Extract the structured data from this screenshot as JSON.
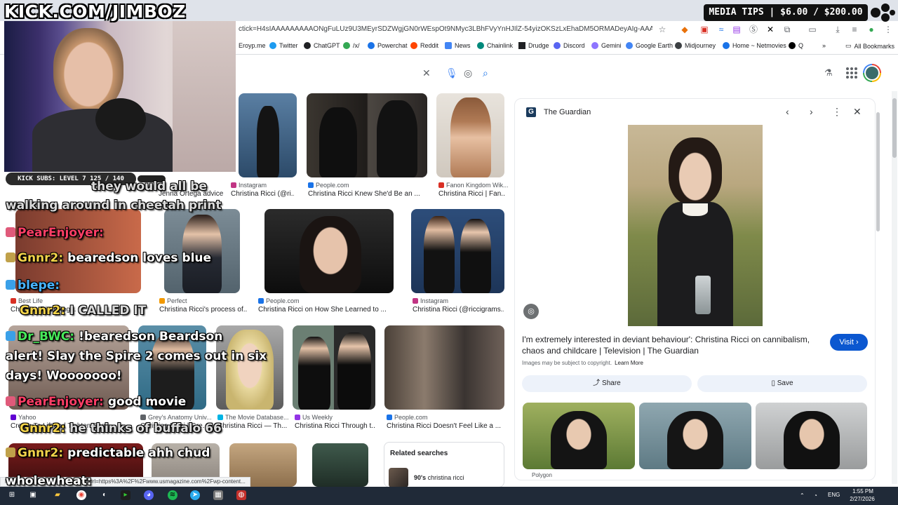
{
  "browser": {
    "url": "ctick=H4sIAAAAAAAAAONgFuLUz9U3MEyrSDZWgjGN0rWEspOt9NMyc3LBhFVyYnHJIlZ-54yizOKSzLxEhaDM5ORMADeyAIg-AAAA&sxsrf=AN...",
    "bookmarks": [
      "Eroyp.me",
      "Twitter",
      "ChatGPT",
      "/x/",
      "Powerchat",
      "Reddit",
      "News",
      "Chainlink",
      "Drudge",
      "Discord",
      "Gemini",
      "Google Earth",
      "Midjourney",
      "Home ~ Netmovies",
      "Q"
    ],
    "all_bookmarks": "All Bookmarks"
  },
  "grid": {
    "row1": [
      {
        "source": "Instagram",
        "caption": "Christina Ricci (@ri..."
      },
      {
        "source": "People.com",
        "caption": "Christina Ricci Knew She'd Be an ..."
      },
      {
        "source": "Fanon Kingdom Wik...",
        "caption": "Christina Ricci | Fan..."
      }
    ],
    "row1_left_caption": "Jenna Ortega advice",
    "row2": [
      {
        "source": "Best Life",
        "caption": "Christina Ricci Reg..."
      },
      {
        "source": "Perfect",
        "caption": "Christina Ricci's process of..."
      },
      {
        "source": "People.com",
        "caption": "Christina Ricci on How She Learned to ..."
      },
      {
        "source": "Instagram",
        "caption": "Christina Ricci (@riccigrams..."
      }
    ],
    "row3": [
      {
        "source": "Yahoo",
        "caption": "Cream To Lift and Tighten Sag..."
      },
      {
        "source": "Grey's Anatomy Univ...",
        "caption": "Christina Ricci | Gre..."
      },
      {
        "source": "The Movie Database...",
        "caption": "Christina Ricci — Th..."
      },
      {
        "source": "Us Weekly",
        "caption": "Christina Ricci Through t..."
      },
      {
        "source": "People.com",
        "caption": "Christina Ricci Doesn't Feel Like a ..."
      }
    ],
    "related": {
      "title": "Related searches",
      "item_bold": "90's",
      "item_rest": " christina ricci"
    }
  },
  "panel": {
    "source": "The Guardian",
    "title": "I'm extremely interested in deviant behaviour': Christina Ricci on cannibalism, chaos and childcare | Television | The Guardian",
    "visit": "Visit",
    "copyright": "Images may be subject to copyright.",
    "learn_more": "Learn More",
    "share": "Share",
    "save": "Save",
    "related_source": "Polygon"
  },
  "status_url": "https://www.google.com/url?sa=i&url=https%3A%2F%2Fwww.usmagazine.com%2Fwp-content...",
  "taskbar": {
    "lang": "ENG",
    "time": "1:55 PM",
    "date": "2/27/2026"
  },
  "overlay": {
    "kick": "KICK.COM/JIMBOZ",
    "media_tips": "MEDIA TIPS | $6.00 / $200.00",
    "kick_subs": "KICK SUBS: LEVEL 7 125 / 140",
    "chat": [
      {
        "user": "",
        "text": "they would all be"
      },
      {
        "user": "",
        "text": "walking around in cheetah print"
      },
      {
        "user": "PearEnjoyer:",
        "text": ""
      },
      {
        "user": "Gnnr2:",
        "text": "bearedson loves blue"
      },
      {
        "user": "blepe:",
        "text": ""
      },
      {
        "user": "Gnnr2:",
        "text": "I CALLED IT"
      },
      {
        "user": "Dr_BWC:",
        "text": "!bearedson Beardson"
      },
      {
        "user": "",
        "text": "alert! Slay the Spire 2 comes out in six"
      },
      {
        "user": "",
        "text": "days! Wooooooo!"
      },
      {
        "user": "PearEnjoyer:",
        "text": "good movie"
      },
      {
        "user": "Gnnr2:",
        "text": "he thinks of buffalo 66"
      },
      {
        "user": "Gnnr2:",
        "text": "predictable ahh chud"
      },
      {
        "user": "wholewheat:",
        "text": ""
      }
    ]
  }
}
